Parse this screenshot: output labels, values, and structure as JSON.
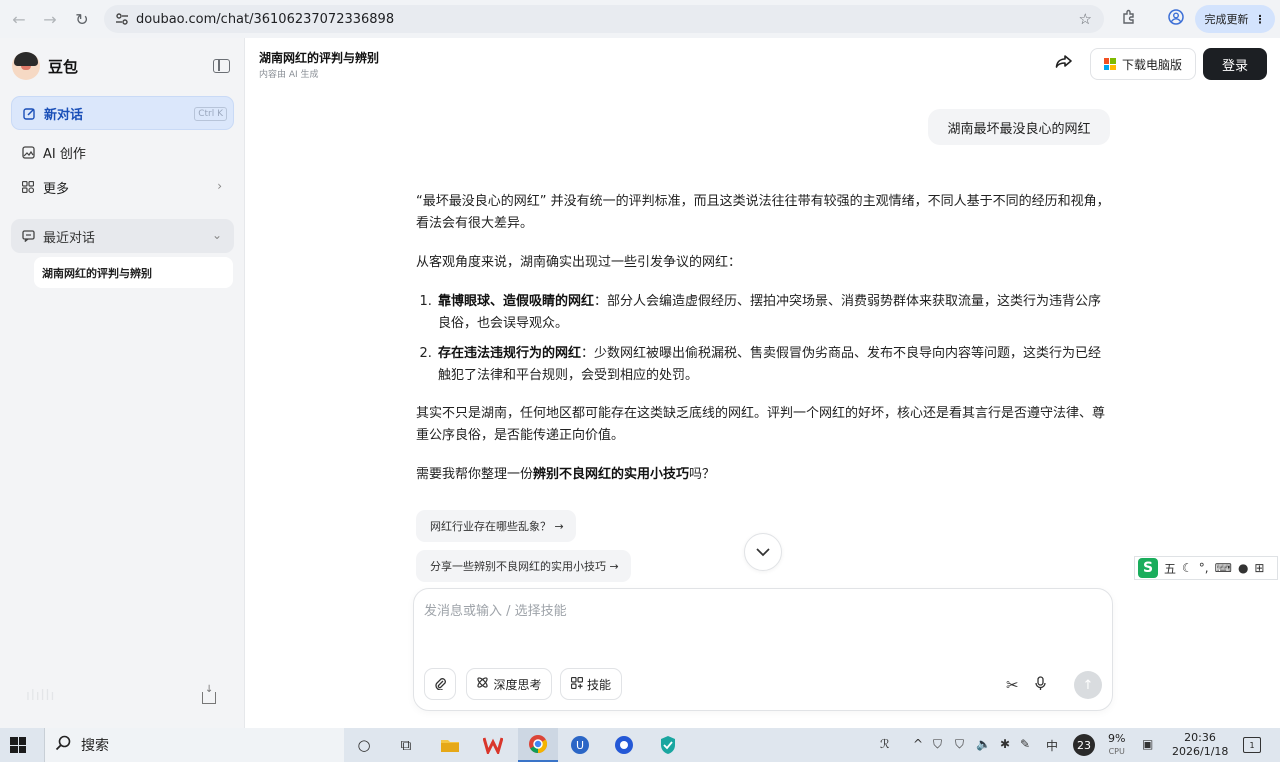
{
  "browser": {
    "url": "doubao.com/chat/36106237072336898",
    "update_label": "完成更新"
  },
  "sidebar": {
    "brand": "豆包",
    "items": [
      {
        "label": "新对话",
        "shortcut": "Ctrl K"
      },
      {
        "label": "AI 创作"
      },
      {
        "label": "更多"
      }
    ],
    "recent_label": "最近对话",
    "recent_items": [
      "湖南网红的评判与辨别"
    ]
  },
  "header": {
    "title": "湖南网红的评判与辨别",
    "subtitle": "内容由 AI 生成",
    "download_label": "下载电脑版",
    "login_label": "登录"
  },
  "chat": {
    "user_message": "湖南最坏最没良心的网红",
    "answer": {
      "p1": "“最坏最没良心的网红” 并没有统一的评判标准，而且这类说法往往带有较强的主观情绪，不同人基于不同的经历和视角，看法会有很大差异。",
      "p2": "从客观角度来说，湖南确实出现过一些引发争议的网红：",
      "list": [
        {
          "title": "靠博眼球、造假吸睛的网红",
          "text": "：部分人会编造虚假经历、摆拍冲突场景、消费弱势群体来获取流量，这类行为违背公序良俗，也会误导观众。"
        },
        {
          "title": "存在违法违规行为的网红",
          "text": "：少数网红被曝出偷税漏税、售卖假冒伪劣商品、发布不良导向内容等问题，这类行为已经触犯了法律和平台规则，会受到相应的处罚。"
        }
      ],
      "p3": "其实不只是湖南，任何地区都可能存在这类缺乏底线的网红。评判一个网红的好坏，核心还是看其言行是否遵守法律、尊重公序良俗，是否能传递正向价值。",
      "p4_pre": "需要我帮你整理一份",
      "p4_bold": "辨别不良网红的实用小技巧",
      "p4_post": "吗？"
    },
    "suggestions": [
      "网红行业存在哪些乱象？ →",
      "分享一些辨别不良网红的实用小技巧 →"
    ]
  },
  "composer": {
    "placeholder": "发消息或输入 / 选择技能",
    "deep_think_label": "深度思考",
    "skills_label": "技能"
  },
  "ime": {
    "mode": "五"
  },
  "taskbar": {
    "search_label": "搜索",
    "weather_badge": "23",
    "cpu_value": "9%",
    "cpu_label": "CPU",
    "time": "20:36",
    "date": "2026/1/18",
    "notification_count": "1",
    "ime_lang": "中"
  },
  "colors": {
    "accent": "#1a4fb8",
    "login_bg": "#1c1f23",
    "sidebar_bg": "#f3f4f6"
  }
}
